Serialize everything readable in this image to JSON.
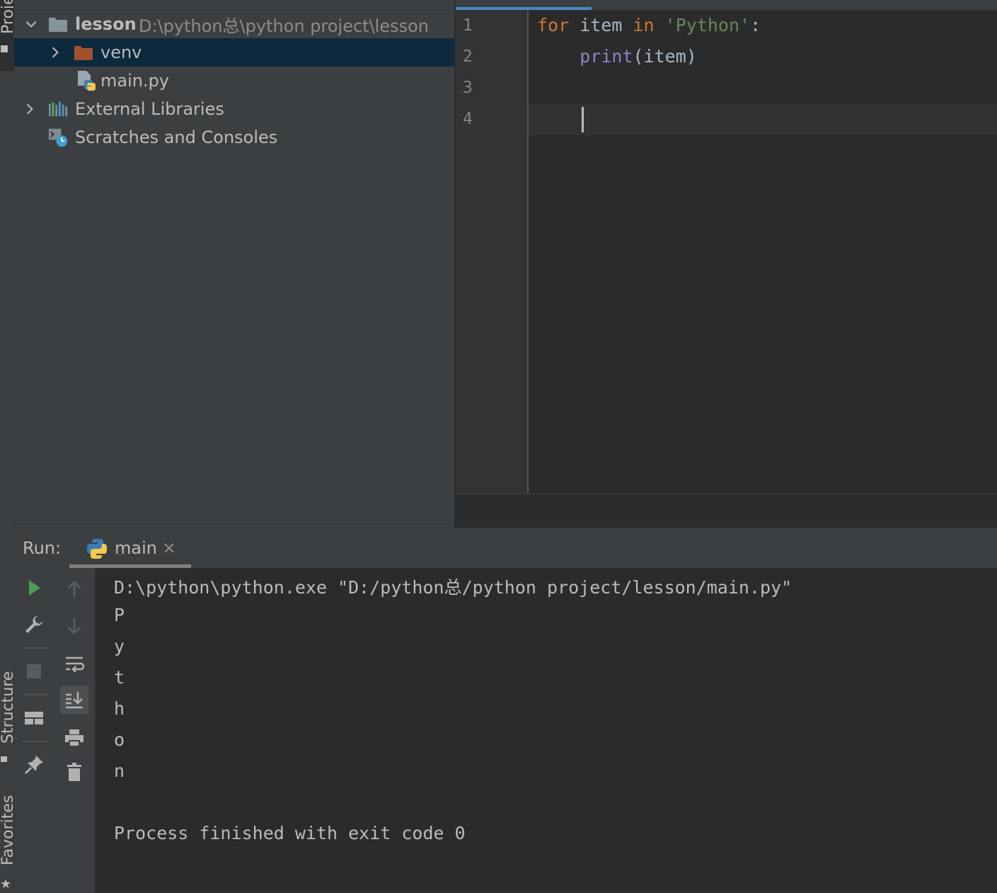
{
  "side_tabs": {
    "project": "Proje",
    "structure": "Structure",
    "favorites": "Favorites"
  },
  "project_tree": {
    "root": {
      "name": "lesson",
      "path": "D:\\python总\\python project\\lesson"
    },
    "venv": "venv",
    "main_file": "main.py",
    "external_libraries": "External Libraries",
    "scratches": "Scratches and Consoles"
  },
  "editor": {
    "line_numbers": [
      "1",
      "2",
      "3",
      "4"
    ],
    "code": {
      "line1": {
        "kw_for": "for",
        "var": " item ",
        "kw_in": "in",
        "space": " ",
        "string": "'Python'",
        "colon": ":"
      },
      "line2": {
        "indent": "    ",
        "builtin": "print",
        "args": "(item)"
      }
    }
  },
  "run_panel": {
    "label": "Run:",
    "tab_name": "main",
    "console": {
      "command": "D:\\python\\python.exe \"D:/python总/python project/lesson/main.py\"",
      "output": [
        "P",
        "y",
        "t",
        "h",
        "o",
        "n"
      ],
      "exit_message": "Process finished with exit code 0"
    }
  },
  "colors": {
    "keyword": "#cc7832",
    "string": "#6a8759",
    "builtin": "#8888c6",
    "run_green": "#499c54",
    "folder_orange": "#a0522d",
    "selection": "#0d293e"
  }
}
